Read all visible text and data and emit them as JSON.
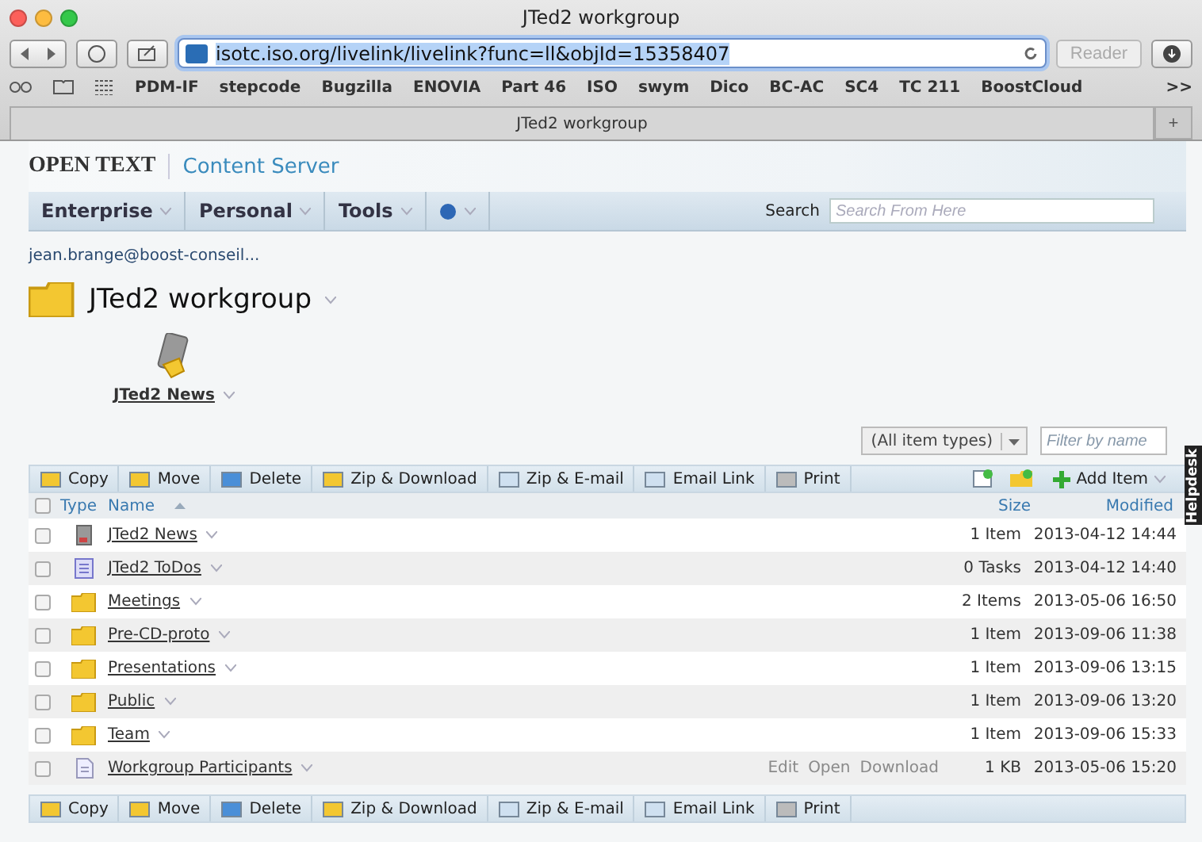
{
  "window": {
    "title": "JTed2 workgroup"
  },
  "address_bar": {
    "url": "isotc.iso.org/livelink/livelink?func=ll&objId=15358407",
    "reader": "Reader"
  },
  "bookmarks": [
    "PDM-IF",
    "stepcode",
    "Bugzilla",
    "ENOVIA",
    "Part 46",
    "ISO",
    "swym",
    "Dico",
    "BC-AC",
    "SC4",
    "TC 211",
    "BoostCloud"
  ],
  "more_bookmarks": ">>",
  "tabs": [
    {
      "label": "JTed2 workgroup",
      "selected": true
    }
  ],
  "new_tab": "+",
  "header": {
    "brand": "OPEN TEXT",
    "product": "Content Server"
  },
  "nav": {
    "menus": [
      "Enterprise",
      "Personal",
      "Tools"
    ],
    "search_label": "Search",
    "search_placeholder": "Search From Here"
  },
  "breadcrumb": "jean.brange@boost-conseil...",
  "folder_title": "JTed2 workgroup",
  "featured": {
    "label": "JTed2 News"
  },
  "filter": {
    "type_select": "(All item types)",
    "placeholder": "Filter by name"
  },
  "actions_top": [
    "Copy",
    "Move",
    "Delete",
    "Zip & Download",
    "Zip & E-mail",
    "Email Link",
    "Print"
  ],
  "actions_bottom": [
    "Copy",
    "Move",
    "Delete",
    "Zip & Download",
    "Zip & E-mail",
    "Email Link",
    "Print"
  ],
  "select_all_checked": false,
  "add_item": "Add Item",
  "columns": {
    "type": "Type",
    "name": "Name",
    "size": "Size",
    "modified": "Modified"
  },
  "rows": [
    {
      "kind": "news",
      "name": "JTed2 News",
      "size": "1 Item",
      "modified": "2013-04-12 14:44",
      "checked": false
    },
    {
      "kind": "tasks",
      "name": "JTed2 ToDos",
      "size": "0 Tasks",
      "modified": "2013-04-12 14:40",
      "checked": false
    },
    {
      "kind": "folder",
      "name": "Meetings",
      "size": "2 Items",
      "modified": "2013-05-06 16:50",
      "checked": false
    },
    {
      "kind": "folder",
      "name": "Pre-CD-proto",
      "size": "1 Item",
      "modified": "2013-09-06 11:38",
      "checked": false
    },
    {
      "kind": "folder",
      "name": "Presentations",
      "size": "1 Item",
      "modified": "2013-09-06 13:15",
      "checked": false
    },
    {
      "kind": "folder",
      "name": "Public",
      "size": "1 Item",
      "modified": "2013-09-06 13:20",
      "checked": false
    },
    {
      "kind": "folder",
      "name": "Team",
      "size": "1 Item",
      "modified": "2013-09-06 15:33",
      "checked": false
    },
    {
      "kind": "document",
      "name": "Workgroup Participants",
      "size": "1 KB",
      "modified": "2013-05-06 15:20",
      "checked": false,
      "row_actions": [
        "Edit",
        "Open",
        "Download"
      ]
    }
  ],
  "helpdesk": "Helpdesk"
}
